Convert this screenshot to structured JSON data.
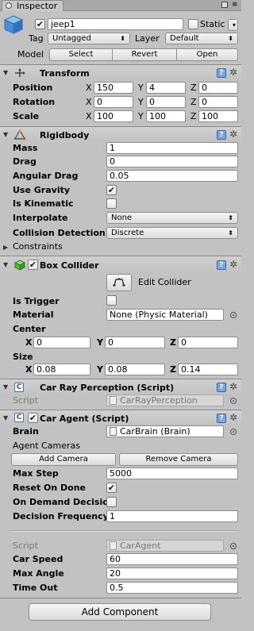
{
  "tab": {
    "title": "Inspector",
    "lock_icon": "lock-icon",
    "menu_icon": "menu-icon"
  },
  "object": {
    "name": "jeep1",
    "static_label": "Static",
    "tag_label": "Tag",
    "tag_value": "Untagged",
    "layer_label": "Layer",
    "layer_value": "Default",
    "model_label": "Model",
    "select": "Select",
    "revert": "Revert",
    "open": "Open"
  },
  "transform": {
    "title": "Transform",
    "position": "Position",
    "rotation": "Rotation",
    "scale": "Scale",
    "x": "X",
    "y": "Y",
    "z": "Z",
    "pos": [
      "150",
      "4",
      "0"
    ],
    "rot": [
      "0",
      "0",
      "0"
    ],
    "scl": [
      "100",
      "100",
      "100"
    ]
  },
  "rigidbody": {
    "title": "Rigidbody",
    "mass_label": "Mass",
    "mass": "1",
    "drag_label": "Drag",
    "drag": "0",
    "angular_drag_label": "Angular Drag",
    "angular_drag": "0.05",
    "use_gravity_label": "Use Gravity",
    "is_kinematic_label": "Is Kinematic",
    "interpolate_label": "Interpolate",
    "interpolate_value": "None",
    "collision_label": "Collision Detection",
    "collision_value": "Discrete",
    "constraints_label": "Constraints"
  },
  "box_collider": {
    "title": "Box Collider",
    "edit_collider": "Edit Collider",
    "is_trigger_label": "Is Trigger",
    "material_label": "Material",
    "material_value": "None (Physic Material)",
    "center_label": "Center",
    "center": [
      "0",
      "0",
      "0"
    ],
    "size_label": "Size",
    "size": [
      "0.08",
      "0.08",
      "0.14"
    ],
    "x": "X",
    "y": "Y",
    "z": "Z"
  },
  "car_ray": {
    "title": "Car Ray Perception (Script)",
    "script_label": "Script",
    "script_value": "CarRayPerception"
  },
  "car_agent": {
    "title": "Car Agent (Script)",
    "brain_label": "Brain",
    "brain_value": "CarBrain (Brain)",
    "agent_cameras_label": "Agent Cameras",
    "add_camera": "Add Camera",
    "remove_camera": "Remove Camera",
    "max_step_label": "Max Step",
    "max_step": "5000",
    "reset_on_done_label": "Reset On Done",
    "on_demand_label": "On Demand Decisions",
    "decision_freq_label": "Decision Frequency",
    "decision_freq": "1",
    "script_label": "Script",
    "script_value": "CarAgent",
    "car_speed_label": "Car Speed",
    "car_speed": "60",
    "max_angle_label": "Max Angle",
    "max_angle": "20",
    "time_out_label": "Time Out",
    "time_out": "0.5"
  },
  "add_component": "Add Component"
}
